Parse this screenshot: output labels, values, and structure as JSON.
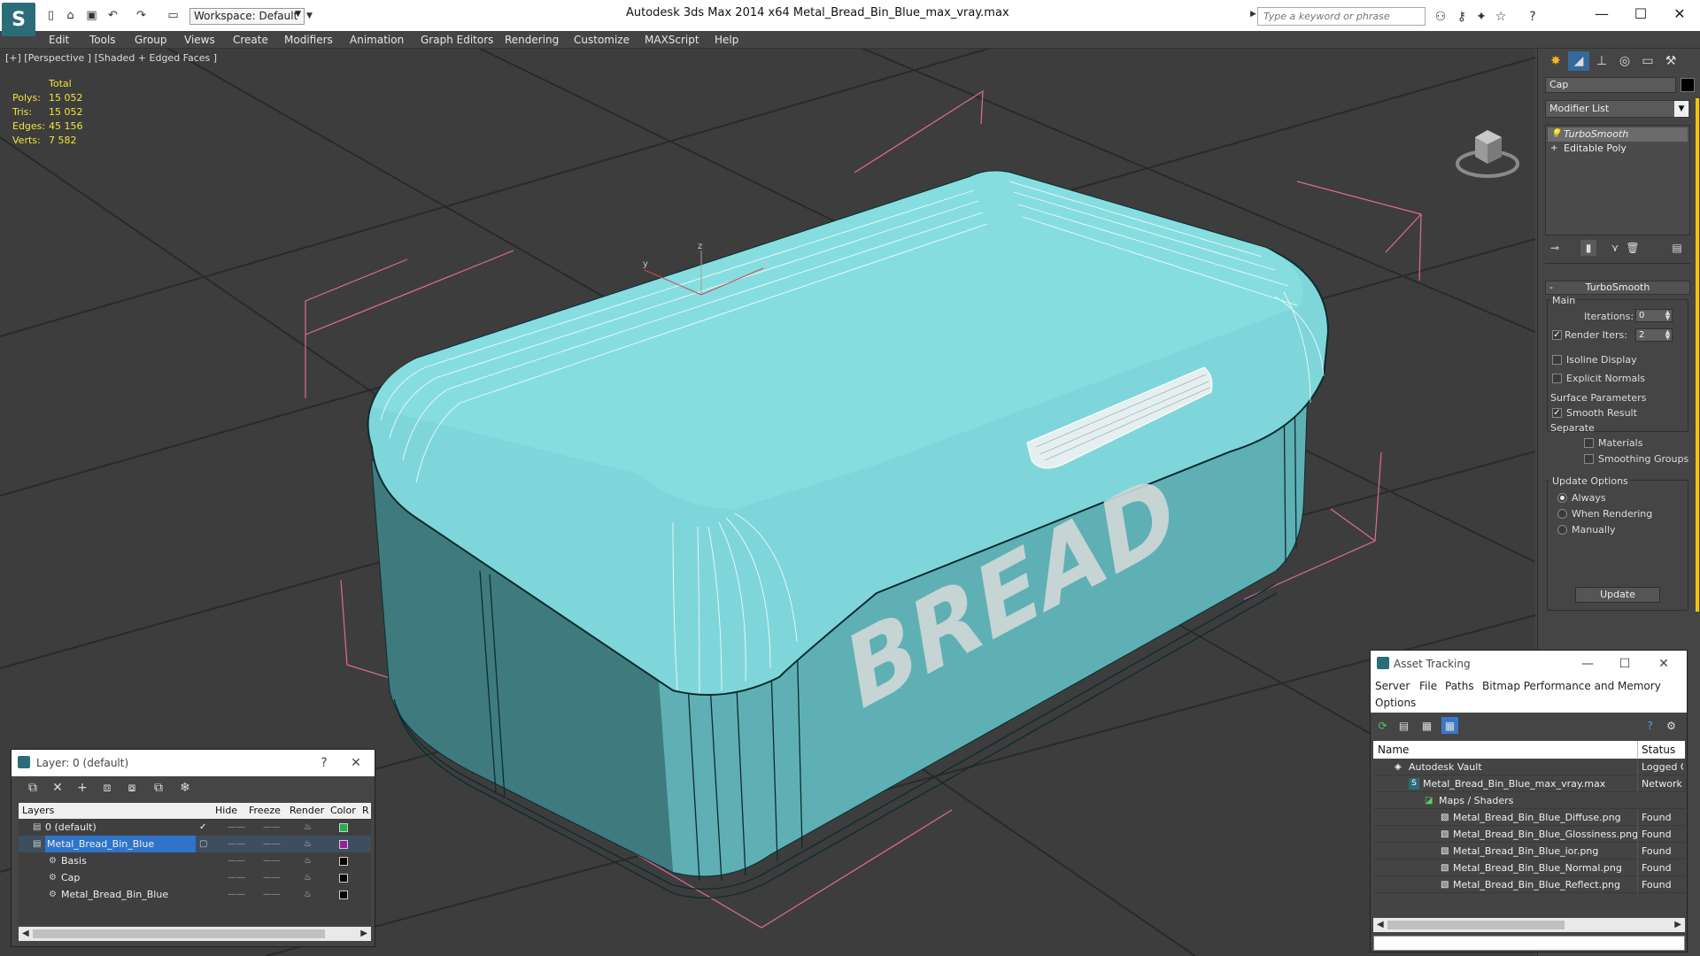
{
  "app": {
    "title": "Autodesk 3ds Max  2014 x64      Metal_Bread_Bin_Blue_max_vray.max",
    "workspace": "Workspace: Default",
    "search_placeholder": "Type a keyword or phrase",
    "accent_color": "#2a6d78"
  },
  "menu": [
    "Edit",
    "Tools",
    "Group",
    "Views",
    "Create",
    "Modifiers",
    "Animation",
    "Graph Editors",
    "Rendering",
    "Customize",
    "MAXScript",
    "Help"
  ],
  "viewport": {
    "label": "[+] [Perspective ] [Shaded + Edged Faces ]",
    "stats": {
      "header": "Total",
      "rows": [
        {
          "k": "Polys:",
          "v": "15 052"
        },
        {
          "k": "Tris:",
          "v": "15 052"
        },
        {
          "k": "Edges:",
          "v": "45 156"
        },
        {
          "k": "Verts:",
          "v": "7 582"
        }
      ]
    },
    "model_text": "BREAD",
    "axes": {
      "x": "x",
      "y": "y",
      "z": "z"
    },
    "model_color": "#86d8dc"
  },
  "command_panel": {
    "object_name": "Cap",
    "modifier_list": "Modifier List",
    "stack": [
      "TurboSmooth",
      "Editable Poly"
    ],
    "rollout": "TurboSmooth",
    "main_label": "Main",
    "iterations_label": "Iterations:",
    "iterations_value": "0",
    "render_iters_label": "Render Iters:",
    "render_iters_value": "2",
    "isoline_label": "Isoline Display",
    "explicit_label": "Explicit Normals",
    "surface_label": "Surface Parameters",
    "smooth_label": "Smooth Result",
    "separate_label": "Separate",
    "materials_label": "Materials",
    "smoothing_label": "Smoothing Groups",
    "update_options_label": "Update Options",
    "always_label": "Always",
    "when_rendering_label": "When Rendering",
    "manually_label": "Manually",
    "update_button": "Update"
  },
  "layer_panel": {
    "title": "Layer: 0 (default)",
    "help": "?",
    "columns": [
      "Layers",
      "Hide",
      "Freeze",
      "Render",
      "Color",
      "R"
    ],
    "rows": [
      {
        "name": "0 (default)",
        "color": "#1db34a"
      },
      {
        "name": "Metal_Bread_Bin_Blue",
        "color": "#9a1fa0"
      },
      {
        "name": "Basis",
        "color": "#000000"
      },
      {
        "name": "Cap",
        "color": "#000000"
      },
      {
        "name": "Metal_Bread_Bin_Blue",
        "color": "#000000"
      }
    ]
  },
  "asset_panel": {
    "title": "Asset Tracking",
    "menu": [
      "Server",
      "File",
      "Paths",
      "Bitmap Performance and Memory",
      "Options"
    ],
    "columns": [
      "Name",
      "Status"
    ],
    "rows": [
      {
        "name": "Autodesk Vault",
        "status": "Logged O"
      },
      {
        "name": "Metal_Bread_Bin_Blue_max_vray.max",
        "status": "Network"
      },
      {
        "name": "Maps / Shaders",
        "status": ""
      },
      {
        "name": "Metal_Bread_Bin_Blue_Diffuse.png",
        "status": "Found"
      },
      {
        "name": "Metal_Bread_Bin_Blue_Glossiness.png",
        "status": "Found"
      },
      {
        "name": "Metal_Bread_Bin_Blue_ior.png",
        "status": "Found"
      },
      {
        "name": "Metal_Bread_Bin_Blue_Normal.png",
        "status": "Found"
      },
      {
        "name": "Metal_Bread_Bin_Blue_Reflect.png",
        "status": "Found"
      }
    ]
  }
}
